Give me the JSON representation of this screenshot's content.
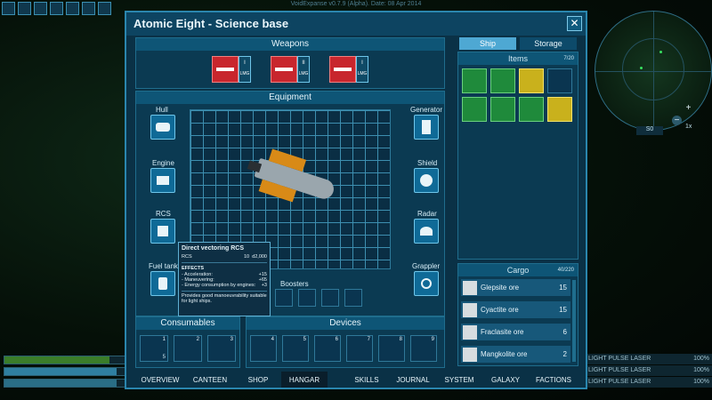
{
  "topbar": {
    "version": "VoidExpanse v0.7.9 (Alpha). Date: 08 Apr 2014"
  },
  "window": {
    "title": "Atomic Eight - Science base",
    "close_symbol": "✕"
  },
  "weapons": {
    "header": "Weapons",
    "slots": [
      {
        "tag": "LMG",
        "roman": "I"
      },
      {
        "tag": "LMG",
        "roman": "II"
      },
      {
        "tag": "LMG",
        "roman": "I"
      }
    ]
  },
  "equipment": {
    "header": "Equipment",
    "left": [
      "Hull",
      "Engine",
      "RCS",
      "Fuel tank"
    ],
    "right": [
      "Generator",
      "Shield",
      "Radar",
      "Grappler"
    ],
    "boosters": "Boosters"
  },
  "tooltip": {
    "title": "Direct vectoring RCS",
    "type": "RCS",
    "stat1": "10",
    "stat2": "d2,000",
    "effects_label": "EFFECTS",
    "effects": [
      {
        "name": "- Acceleration:",
        "value": "+15"
      },
      {
        "name": "- Maneuvering:",
        "value": "+65"
      },
      {
        "name": "- Energy consumption by engines:",
        "value": "+3"
      }
    ],
    "desc": "Provides good manoeuvrability suitable for light ships."
  },
  "consumables": {
    "header": "Consumables",
    "slots": [
      "1",
      "2",
      "3"
    ],
    "count": "5"
  },
  "devices": {
    "header": "Devices",
    "slots": [
      "4",
      "5",
      "6",
      "7",
      "8",
      "9"
    ]
  },
  "right_tabs": {
    "ship": "Ship",
    "storage": "Storage"
  },
  "items": {
    "header": "Items",
    "count": "7/20"
  },
  "cargo": {
    "header": "Cargo",
    "count": "40/220",
    "rows": [
      {
        "name": "Glepsite ore",
        "qty": "15"
      },
      {
        "name": "Cyactite ore",
        "qty": "15"
      },
      {
        "name": "Fraclasite ore",
        "qty": "6"
      },
      {
        "name": "Mangkolite ore",
        "qty": "2"
      }
    ]
  },
  "nav": [
    "OVERVIEW",
    "CANTEEN",
    "SHOP",
    "HANGAR",
    "SKILLS",
    "JOURNAL",
    "SYSTEM",
    "GALAXY",
    "FACTIONS"
  ],
  "radar": {
    "label": "S0",
    "plus": "+",
    "minus": "−",
    "zoom": "1x"
  },
  "hud_right": [
    {
      "name": "LIGHT PULSE LASER",
      "pct": "100%"
    },
    {
      "name": "LIGHT PULSE LASER",
      "pct": "100%"
    },
    {
      "name": "LIGHT PULSE LASER",
      "pct": "100%"
    }
  ],
  "colors": {
    "accent": "#0e5576",
    "panel": "#0b3a52",
    "green_item": "#1f8a3b",
    "yellow_item": "#c9b11c"
  }
}
